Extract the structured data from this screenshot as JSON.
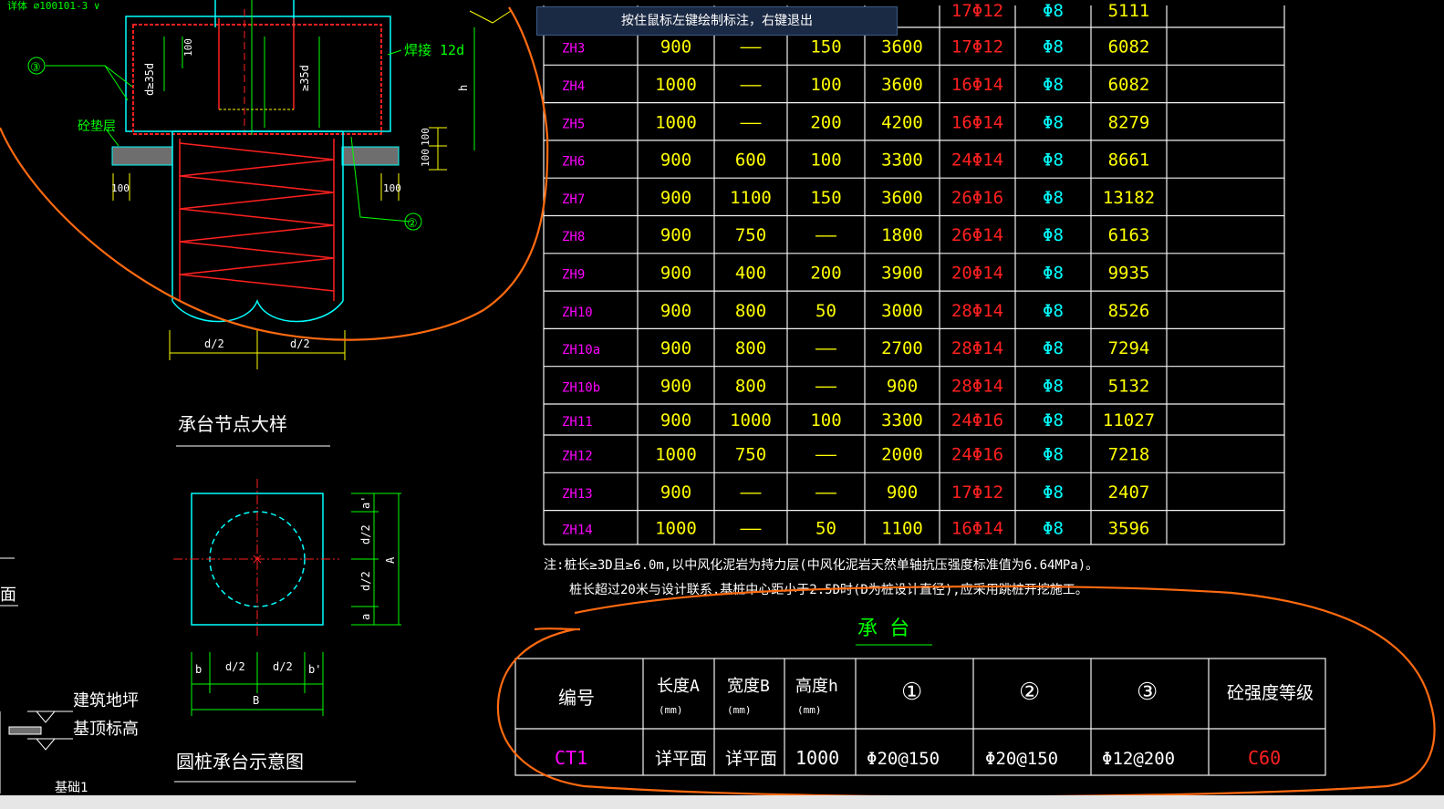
{
  "tooltip": "按住鼠标左键绘制标注，右键退出",
  "detail": {
    "title_cap_detail": "承台节点大样",
    "title_round_pile": "圆桩承台示意图",
    "weld_label": "焊接 12d",
    "cushion_label": "砼垫层",
    "ref_label_ground": "建筑地坪",
    "ref_label_top": "基顶标高",
    "ref_label_foundation": "基础1",
    "dim_100": "100",
    "dim_35d": "≥35d",
    "dim_35d_alt": "d≥35d",
    "dim_h": "h",
    "dim_half_d": "d/2",
    "dim_a": "a",
    "dim_a_prime": "a'",
    "dim_A": "A",
    "dim_b": "b",
    "dim_b_prime": "b'",
    "dim_B": "B",
    "circle_2": "②",
    "circle_3": "③",
    "side_text": "面",
    "top_crop_text": "详体 ⌀100101-3 ∨"
  },
  "pile_table": {
    "partial_row": {
      "code": "",
      "dia": "",
      "b": "",
      "c": "",
      "len": "",
      "bar": "17Φ12",
      "stir": "Φ8",
      "vol": "5111"
    },
    "rows": [
      {
        "code": "ZH3",
        "dia": "900",
        "b": "——",
        "c": "150",
        "len": "3600",
        "bar": "17Φ12",
        "stir": "Φ8",
        "vol": "6082"
      },
      {
        "code": "ZH4",
        "dia": "1000",
        "b": "——",
        "c": "100",
        "len": "3600",
        "bar": "16Φ14",
        "stir": "Φ8",
        "vol": "6082"
      },
      {
        "code": "ZH5",
        "dia": "1000",
        "b": "——",
        "c": "200",
        "len": "4200",
        "bar": "16Φ14",
        "stir": "Φ8",
        "vol": "8279"
      },
      {
        "code": "ZH6",
        "dia": "900",
        "b": "600",
        "c": "100",
        "len": "3300",
        "bar": "24Φ14",
        "stir": "Φ8",
        "vol": "8661"
      },
      {
        "code": "ZH7",
        "dia": "900",
        "b": "1100",
        "c": "150",
        "len": "3600",
        "bar": "26Φ16",
        "stir": "Φ8",
        "vol": "13182"
      },
      {
        "code": "ZH8",
        "dia": "900",
        "b": "750",
        "c": "——",
        "len": "1800",
        "bar": "26Φ14",
        "stir": "Φ8",
        "vol": "6163"
      },
      {
        "code": "ZH9",
        "dia": "900",
        "b": "400",
        "c": "200",
        "len": "3900",
        "bar": "20Φ14",
        "stir": "Φ8",
        "vol": "9935"
      },
      {
        "code": "ZH10",
        "dia": "900",
        "b": "800",
        "c": "50",
        "len": "3000",
        "bar": "28Φ14",
        "stir": "Φ8",
        "vol": "8526"
      },
      {
        "code": "ZH10a",
        "dia": "900",
        "b": "800",
        "c": "——",
        "len": "2700",
        "bar": "28Φ14",
        "stir": "Φ8",
        "vol": "7294"
      },
      {
        "code": "ZH10b",
        "dia": "900",
        "b": "800",
        "c": "——",
        "len": "900",
        "bar": "28Φ14",
        "stir": "Φ8",
        "vol": "5132"
      },
      {
        "code": "ZH11",
        "dia": "900",
        "b": "1000",
        "c": "100",
        "len": "3300",
        "bar": "24Φ16",
        "stir": "Φ8",
        "vol": "11027"
      },
      {
        "code": "ZH12",
        "dia": "1000",
        "b": "750",
        "c": "——",
        "len": "2000",
        "bar": "24Φ16",
        "stir": "Φ8",
        "vol": "7218"
      },
      {
        "code": "ZH13",
        "dia": "900",
        "b": "——",
        "c": "——",
        "len": "900",
        "bar": "17Φ12",
        "stir": "Φ8",
        "vol": "2407"
      },
      {
        "code": "ZH14",
        "dia": "1000",
        "b": "——",
        "c": "50",
        "len": "1100",
        "bar": "16Φ14",
        "stir": "Φ8",
        "vol": "3596"
      }
    ],
    "note_line1": "注:桩长≥3D且≥6.0m,以中风化泥岩为持力层(中风化泥岩天然单轴抗压强度标准值为6.64MPa)。",
    "note_line2": "桩长超过20米与设计联系,基桩中心距小于2.5D时(D为桩设计直径),应采用跳桩开挖施工。"
  },
  "cap_table": {
    "title": "承 台",
    "headers": {
      "code": "编号",
      "length": "长度A",
      "width": "宽度B",
      "height": "高度h",
      "unit": "(mm)",
      "c1": "①",
      "c2": "②",
      "c3": "③",
      "grade": "砼强度等级"
    },
    "row": {
      "code": "CT1",
      "length": "详平面",
      "width": "详平面",
      "height": "1000",
      "c1": "Φ20@150",
      "c2": "Φ20@150",
      "c3": "Φ12@200",
      "grade": "C60"
    }
  },
  "colors": {
    "white": "#ffffff",
    "cyan": "#00ffff",
    "yellow": "#ffff00",
    "green": "#00ff00",
    "magenta": "#ff00ff",
    "red": "#ff2020",
    "orange": "#ff6a10",
    "table_line": "#f2f2f2"
  }
}
